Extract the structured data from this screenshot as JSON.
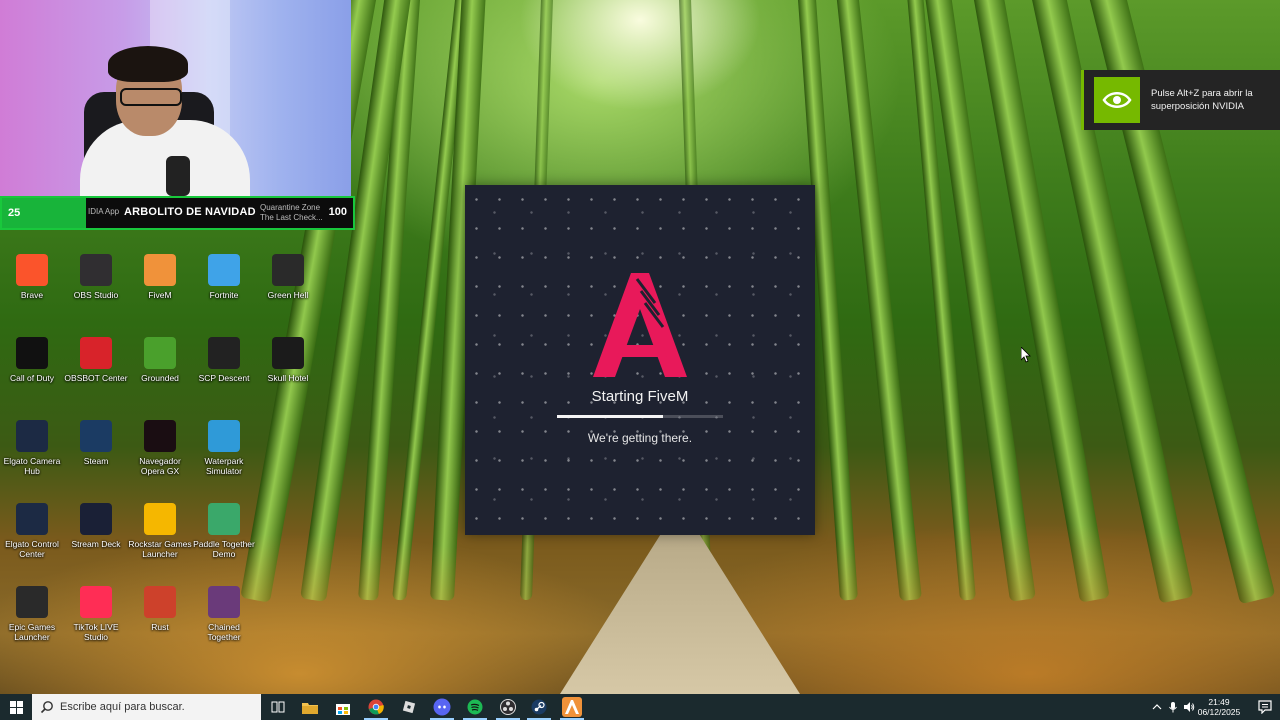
{
  "streambar": {
    "left_count": "25",
    "prefix": "IDIA App",
    "goal": "ARBOLITO DE NAVIDAD",
    "song_line1": "Quarantine Zone",
    "song_line2": "The Last Check...",
    "right_count": "100"
  },
  "desktop_icons": [
    {
      "label": "Brave",
      "icon": "brave-icon",
      "color": "#fb542b"
    },
    {
      "label": "OBS Studio",
      "icon": "obs-icon",
      "color": "#302e31"
    },
    {
      "label": "FiveM",
      "icon": "fivem-icon",
      "color": "#f0923a"
    },
    {
      "label": "Fortnite",
      "icon": "fortnite-icon",
      "color": "#3fa3e8"
    },
    {
      "label": "Green Hell",
      "icon": "green-hell-icon",
      "color": "#2a2a2a"
    },
    {
      "label": "Call of Duty",
      "icon": "call-of-duty-icon",
      "color": "#111111"
    },
    {
      "label": "OBSBOT Center",
      "icon": "obsbot-icon",
      "color": "#d8232a"
    },
    {
      "label": "Grounded",
      "icon": "grounded-icon",
      "color": "#4aa02c"
    },
    {
      "label": "SCP Descent",
      "icon": "scp-icon",
      "color": "#222222"
    },
    {
      "label": "Skull Hotel",
      "icon": "skull-icon",
      "color": "#1b1b1b"
    },
    {
      "label": "Elgato Camera Hub",
      "icon": "elgato-camera-icon",
      "color": "#1c2a44"
    },
    {
      "label": "Steam",
      "icon": "steam-icon",
      "color": "#1b3b63"
    },
    {
      "label": "Navegador Opera GX",
      "icon": "opera-gx-icon",
      "color": "#1a0d12"
    },
    {
      "label": "Waterpark Simulator",
      "icon": "waterpark-icon",
      "color": "#2f9ad8"
    },
    {
      "label": "Elgato Control Center",
      "icon": "elgato-control-icon",
      "color": "#1c2a44"
    },
    {
      "label": "Stream Deck",
      "icon": "stream-deck-icon",
      "color": "#1a2036"
    },
    {
      "label": "Rockstar Games Launcher",
      "icon": "rockstar-icon",
      "color": "#f5b700"
    },
    {
      "label": "Paddle Together Demo",
      "icon": "paddle-together-icon",
      "color": "#3aa86a"
    },
    {
      "label": "Epic Games Launcher",
      "icon": "epic-games-icon",
      "color": "#2a2a2a"
    },
    {
      "label": "TikTok LIVE Studio",
      "icon": "tiktok-live-icon",
      "color": "#ff2d55"
    },
    {
      "label": "Rust",
      "icon": "rust-icon",
      "color": "#cd412b"
    },
    {
      "label": "Chained Together",
      "icon": "chained-together-icon",
      "color": "#6a3a7a"
    }
  ],
  "splash": {
    "title": "Starting FiveM",
    "subtitle": "We're getting there.",
    "progress": 0.64,
    "accent": "#e8195a",
    "background": "#1e2230"
  },
  "nvidia": {
    "line1": "Pulse Alt+Z para abrir la",
    "line2": "superposición NVIDIA",
    "brand_color": "#76b900"
  },
  "taskbar": {
    "search_placeholder": "Escribe aquí para buscar.",
    "apps": [
      "task-view-icon",
      "file-explorer-icon",
      "store-icon",
      "chrome-icon",
      "roblox-icon",
      "discord-icon",
      "spotify-icon",
      "obs-taskbar-icon",
      "steam-taskbar-icon",
      "fivem-taskbar-icon"
    ],
    "time": "21:49",
    "date": "06/12/2025"
  }
}
